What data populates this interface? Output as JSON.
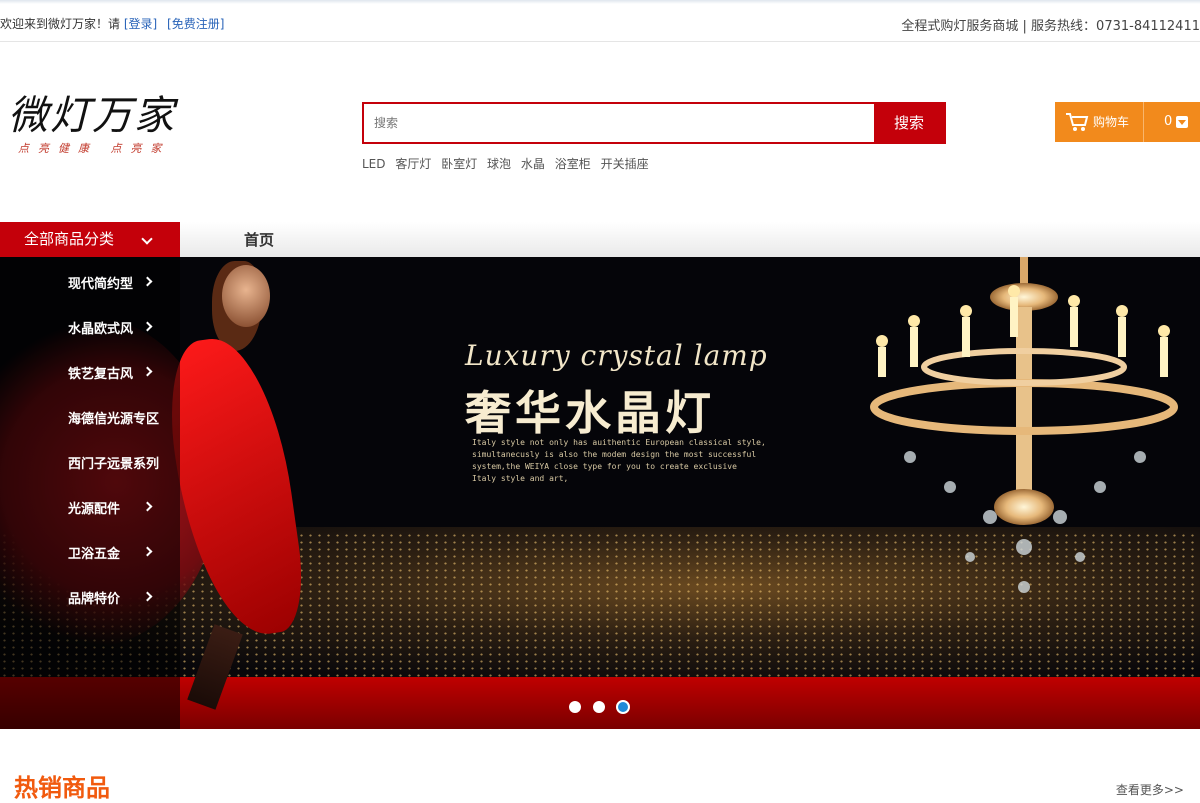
{
  "topbar": {
    "welcome": "欢迎来到微灯万家！请",
    "login": "[登录]",
    "register": "[免费注册]",
    "right_text": "全程式购灯服务商城 | 服务热线：0731-84112411"
  },
  "logo": {
    "title": "微灯万家",
    "slogan": "点亮健康 点亮家"
  },
  "search": {
    "placeholder": "搜索",
    "button": "搜索",
    "hotwords": [
      "LED",
      "客厅灯",
      "卧室灯",
      "球泡",
      "水晶",
      "浴室柜",
      "开关插座"
    ]
  },
  "cart": {
    "label": "购物车",
    "count": "0",
    "icon": "cart-icon"
  },
  "nav": {
    "all_categories": "全部商品分类",
    "home": "首页"
  },
  "categories": [
    {
      "label": "现代简约型",
      "arrow": true
    },
    {
      "label": "水晶欧式风",
      "arrow": true
    },
    {
      "label": "铁艺复古风",
      "arrow": true
    },
    {
      "label": "海德信光源专区",
      "arrow": false
    },
    {
      "label": "西门子远景系列",
      "arrow": false
    },
    {
      "label": "光源配件",
      "arrow": true
    },
    {
      "label": "卫浴五金",
      "arrow": true
    },
    {
      "label": "品牌特价",
      "arrow": true
    }
  ],
  "banner": {
    "headline_en": "Luxury crystal lamp",
    "headline_cn": "奢华水晶灯",
    "desc_lines": [
      "Italy style not only has auithentic European classical style,",
      "simultanecusly is also the modem design the most successful",
      "system,the WEIYA close type for you to create exclusive",
      "Italy style and art,"
    ],
    "slides": 3,
    "active_slide": 3
  },
  "hot": {
    "title": "热销商品",
    "more": "查看更多>>"
  },
  "colors": {
    "brand_red": "#c4000a",
    "cart_orange": "#f28a1c",
    "hot_orange": "#f15a0e",
    "link_blue": "#2a64b9",
    "active_dot": "#1e8ad8"
  }
}
